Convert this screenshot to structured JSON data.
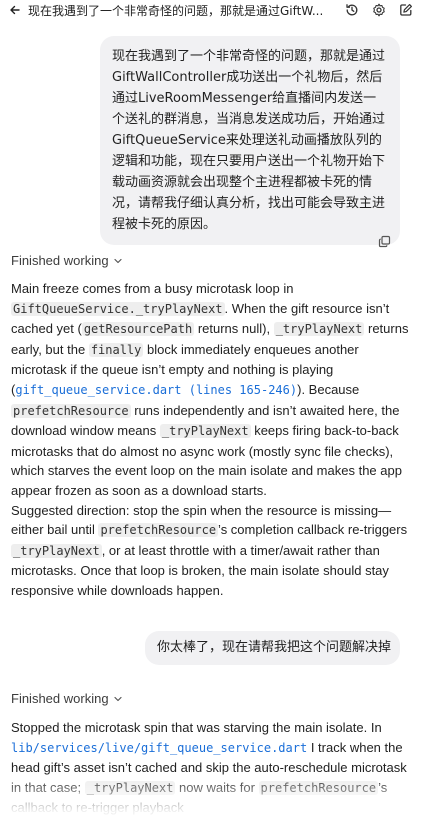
{
  "header": {
    "title": "现在我遇到了一个非常奇怪的问题，那就是通过GiftW...",
    "icons": [
      "back-arrow-icon",
      "history-icon",
      "settings-icon",
      "new-chat-icon"
    ]
  },
  "messages": {
    "user1": {
      "text": "现在我遇到了一个非常奇怪的问题，那就是通过GiftWallController成功送出一个礼物后，然后通过LiveRoomMessenger给直播间内发送一个送礼的群消息，当消息发送成功后，开始通过GiftQueueService来处理送礼动画播放队列的逻辑和功能，现在只要用户送出一个礼物开始下载动画资源就会出现整个主进程都被卡死的情况，请帮我仔细认真分析，找出可能会导致主进程被卡死的原因。"
    },
    "status1": "Finished working",
    "assistant1": {
      "p1_a": "Main freeze comes from a busy microtask loop in ",
      "p1_code1": "GiftQueueService._tryPlayNext",
      "p1_b": ". When the gift resource isn’t cached yet (",
      "p1_code2": "getResourcePath",
      "p1_c": " returns null), ",
      "p1_code3": "_tryPlayNext",
      "p1_d": " returns early, but the ",
      "p1_code4": "finally",
      "p1_e": " block immediately enqueues another microtask if the queue isn’t empty and nothing is playing (",
      "p1_link": "gift_queue_service.dart (lines 165-246)",
      "p1_f": "). Because ",
      "p1_code5": "prefetchResource",
      "p1_g": " runs independently and isn’t awaited here, the download window means ",
      "p1_code6": "_tryPlayNext",
      "p1_h": " keeps firing back-to-back microtasks that do almost no async work (mostly sync file checks), which starves the event loop on the main isolate and makes the app appear frozen as soon as a download starts.",
      "p2_a": "Suggested direction: stop the spin when the resource is missing—either bail until ",
      "p2_code1": "prefetchResource",
      "p2_b": "’s completion callback re-triggers ",
      "p2_code2": "_tryPlayNext",
      "p2_c": ", or at least throttle with a timer/await rather than microtasks. Once that loop is broken, the main isolate should stay responsive while downloads happen."
    },
    "user2": {
      "text": "你太棒了，现在请帮我把这个问题解决掉"
    },
    "status2": "Finished working",
    "assistant2": {
      "a": "Stopped the microtask spin that was starving the main isolate. In ",
      "link": "lib/services/live/gift_queue_service.dart",
      "b": " I track when the head gift’s asset isn’t cached and skip the auto-reschedule microtask in that case; ",
      "code1": "_tryPlayNext",
      "c": " now waits for ",
      "code2": "prefetchResource",
      "d": "’s callback to re-trigger playback"
    }
  },
  "colors": {
    "bubble_bg": "#f1f1f3",
    "code_bg": "#eeeeee",
    "link": "#1a6ed8",
    "text": "#222222"
  }
}
